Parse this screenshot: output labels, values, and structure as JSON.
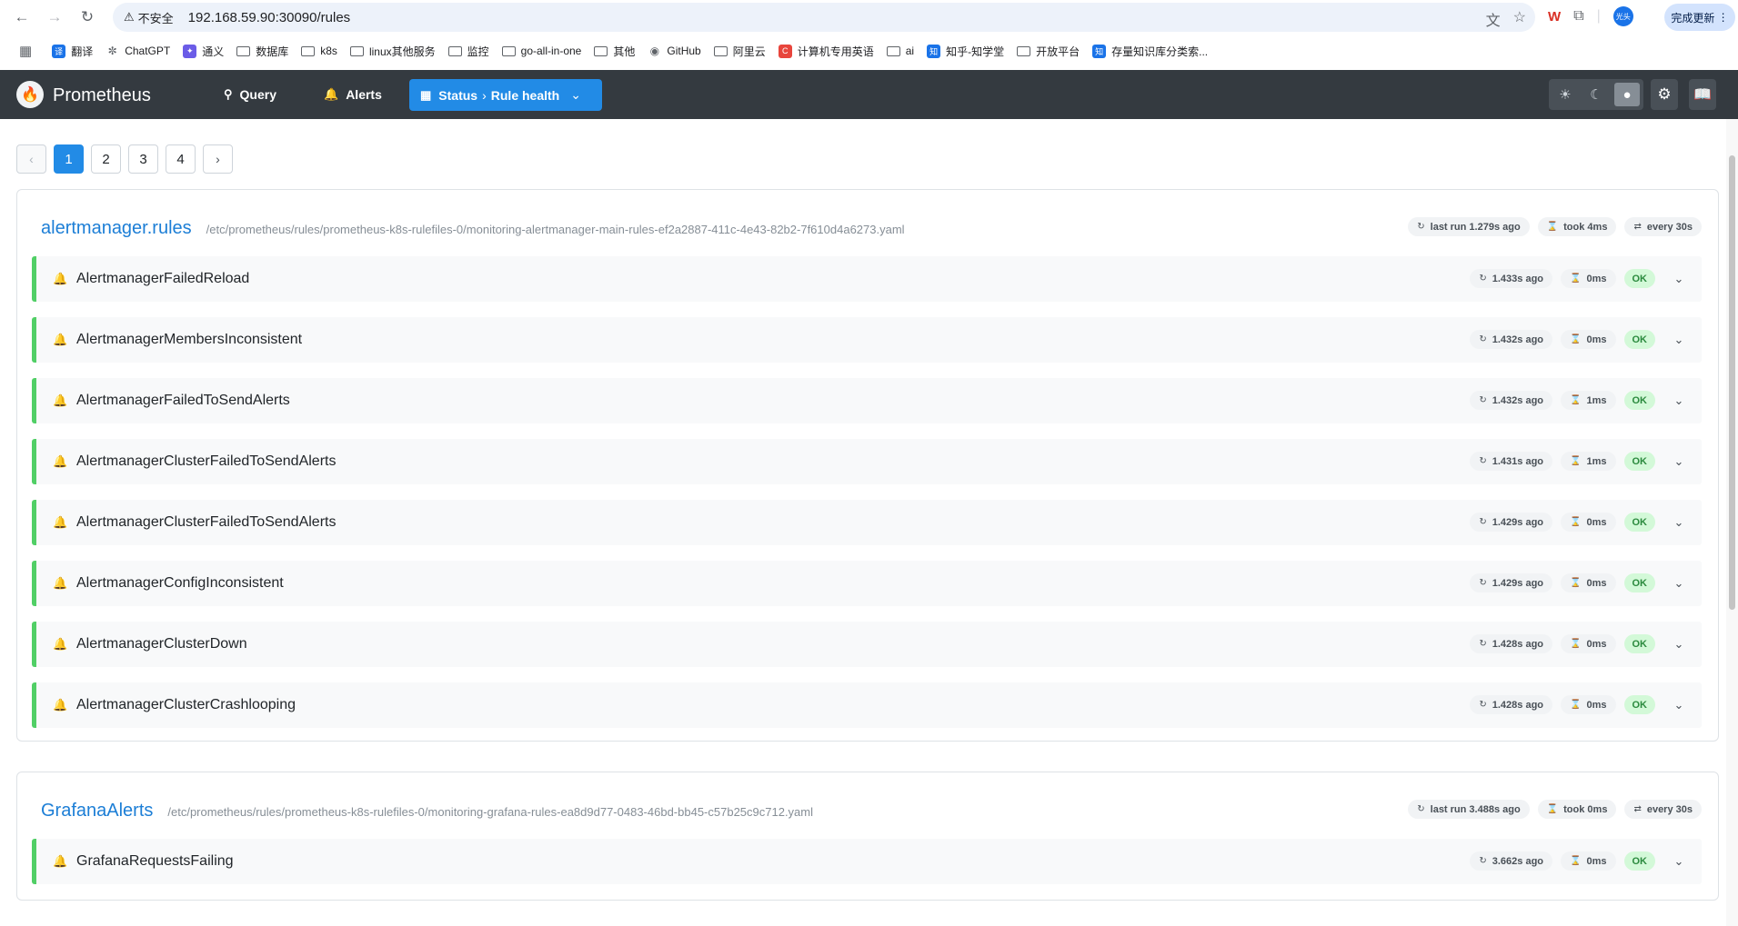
{
  "browser": {
    "security_warning": "不安全",
    "url": "192.168.59.90:30090/rules",
    "update_button": "完成更新",
    "profile_label": "光头",
    "bookmarks": [
      {
        "label": "翻译",
        "icon": "translate-icon"
      },
      {
        "label": "ChatGPT",
        "icon": "chatgpt-icon"
      },
      {
        "label": "通义",
        "icon": "tongyi-icon"
      },
      {
        "label": "数据库",
        "icon": "folder-icon"
      },
      {
        "label": "k8s",
        "icon": "folder-icon"
      },
      {
        "label": "linux其他服务",
        "icon": "folder-icon"
      },
      {
        "label": "监控",
        "icon": "folder-icon"
      },
      {
        "label": "go-all-in-one",
        "icon": "folder-icon"
      },
      {
        "label": "其他",
        "icon": "folder-icon"
      },
      {
        "label": "GitHub",
        "icon": "github-icon"
      },
      {
        "label": "阿里云",
        "icon": "folder-icon"
      },
      {
        "label": "计算机专用英语",
        "icon": "c-icon"
      },
      {
        "label": "ai",
        "icon": "folder-icon"
      },
      {
        "label": "知乎-知学堂",
        "icon": "zhihu-icon"
      },
      {
        "label": "开放平台",
        "icon": "folder-icon"
      },
      {
        "label": "存量知识库分类索...",
        "icon": "zhihu-icon"
      }
    ]
  },
  "header": {
    "brand": "Prometheus",
    "nav": {
      "query": "Query",
      "alerts": "Alerts",
      "status_prefix": "Status",
      "status_page": "Rule health"
    }
  },
  "pagination": {
    "pages": [
      "1",
      "2",
      "3",
      "4"
    ],
    "current": "1"
  },
  "groups": [
    {
      "name": "alertmanager.rules",
      "file": "/etc/prometheus/rules/prometheus-k8s-rulefiles-0/monitoring-alertmanager-main-rules-ef2a2887-411c-4e43-82b2-7f610d4a6273.yaml",
      "last_run": "last run 1.279s ago",
      "took": "took 4ms",
      "interval": "every 30s",
      "rules": [
        {
          "name": "AlertmanagerFailedReload",
          "ago": "1.433s ago",
          "dur": "0ms",
          "health": "OK"
        },
        {
          "name": "AlertmanagerMembersInconsistent",
          "ago": "1.432s ago",
          "dur": "0ms",
          "health": "OK"
        },
        {
          "name": "AlertmanagerFailedToSendAlerts",
          "ago": "1.432s ago",
          "dur": "1ms",
          "health": "OK"
        },
        {
          "name": "AlertmanagerClusterFailedToSendAlerts",
          "ago": "1.431s ago",
          "dur": "1ms",
          "health": "OK"
        },
        {
          "name": "AlertmanagerClusterFailedToSendAlerts",
          "ago": "1.429s ago",
          "dur": "0ms",
          "health": "OK"
        },
        {
          "name": "AlertmanagerConfigInconsistent",
          "ago": "1.429s ago",
          "dur": "0ms",
          "health": "OK"
        },
        {
          "name": "AlertmanagerClusterDown",
          "ago": "1.428s ago",
          "dur": "0ms",
          "health": "OK"
        },
        {
          "name": "AlertmanagerClusterCrashlooping",
          "ago": "1.428s ago",
          "dur": "0ms",
          "health": "OK"
        }
      ]
    },
    {
      "name": "GrafanaAlerts",
      "file": "/etc/prometheus/rules/prometheus-k8s-rulefiles-0/monitoring-grafana-rules-ea8d9d77-0483-46bd-bb45-c57b25c9c712.yaml",
      "last_run": "last run 3.488s ago",
      "took": "took 0ms",
      "interval": "every 30s",
      "rules": [
        {
          "name": "GrafanaRequestsFailing",
          "ago": "3.662s ago",
          "dur": "0ms",
          "health": "OK"
        }
      ]
    }
  ],
  "colors": {
    "header_bg": "#343a40",
    "accent": "#228be6",
    "ok_bg": "#d3f9d8",
    "ok_text": "#2b8a3e",
    "rule_border": "#51cf66"
  }
}
